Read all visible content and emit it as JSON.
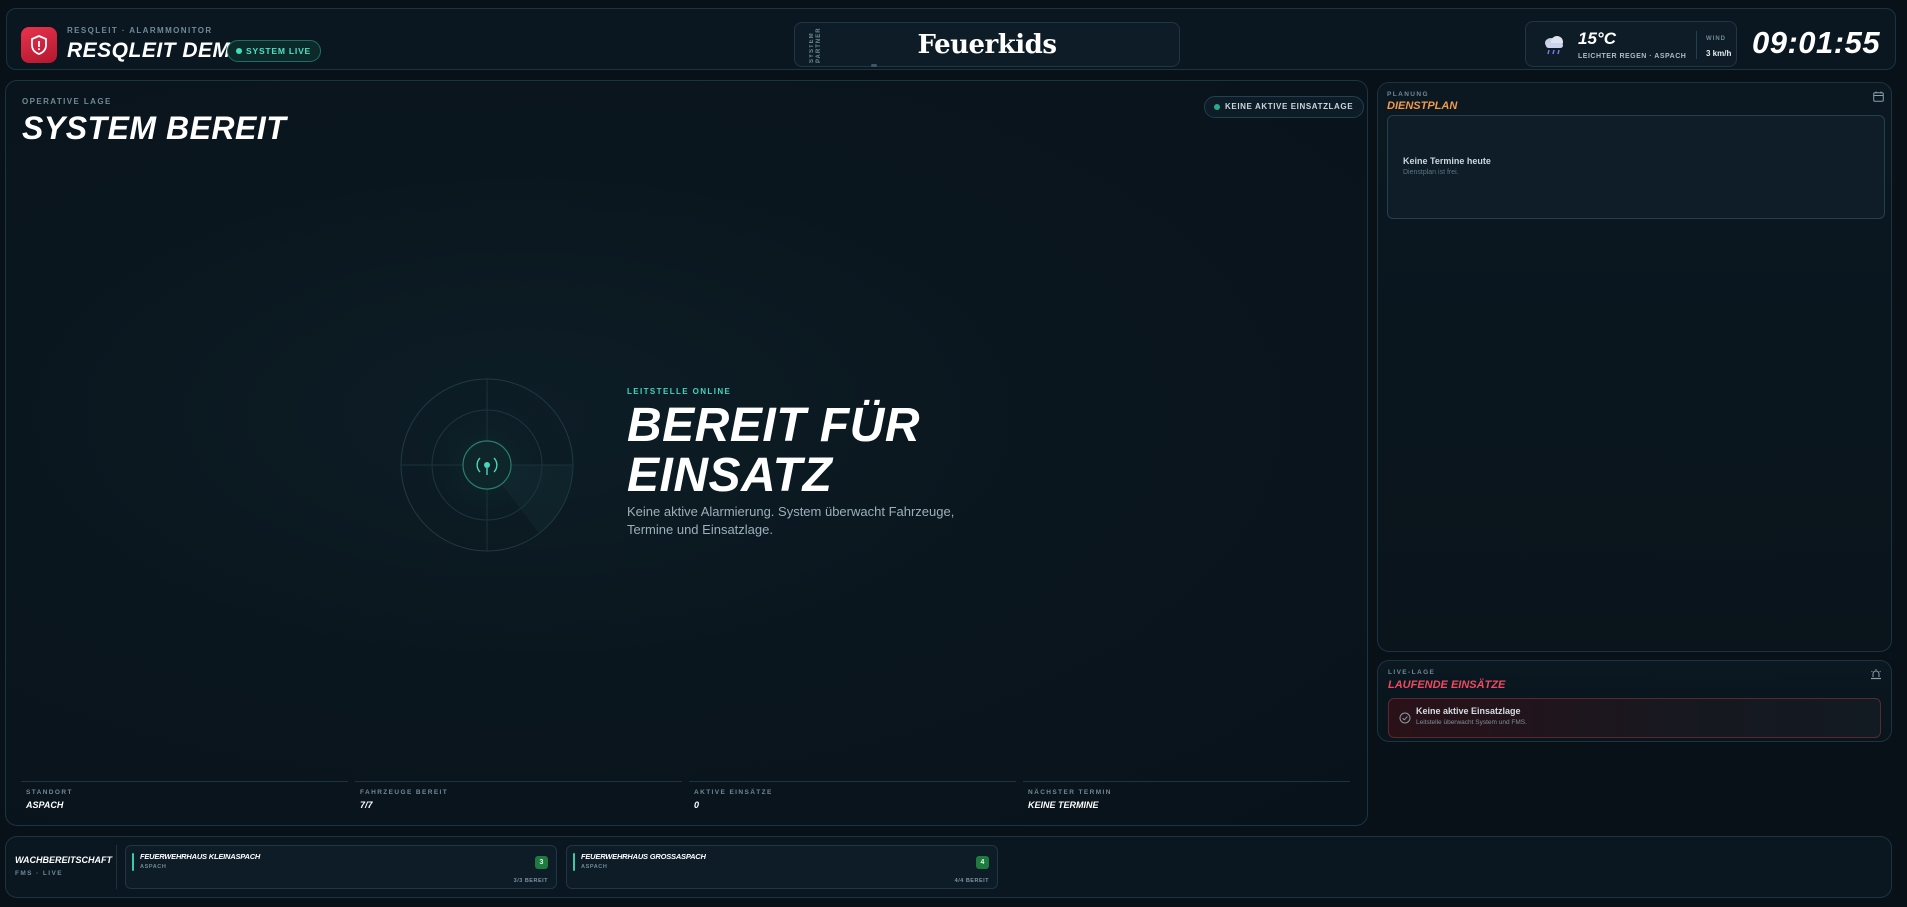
{
  "header": {
    "brand_subtitle": "RESQLEIT · ALARMMONITOR",
    "brand_title": "RESQLEIT DEMO",
    "live_badge": "SYSTEM LIVE",
    "partner_label": "SYSTEM PARTNER",
    "partner_name": "Feuerkids",
    "weather": {
      "icon": "rain-cloud-icon",
      "temperature": "15°C",
      "description": "LEICHTER REGEN · ASPACH",
      "wind_label": "WIND",
      "wind_value": "3 km/h"
    },
    "clock": "09:01:55"
  },
  "main": {
    "label": "OPERATIVE LAGE",
    "title": "SYSTEM BEREIT",
    "status_badge": "KEINE AKTIVE EINSATZLAGE",
    "ready_subtitle": "LEITSTELLE ONLINE",
    "ready_title_line1": "BEREIT FÜR",
    "ready_title_line2": "EINSATZ",
    "ready_text": "Keine aktive Alarmierung. System überwacht Fahrzeuge, Termine und Einsatzlage.",
    "stats": [
      {
        "label": "STANDORT",
        "value": "ASPACH"
      },
      {
        "label": "FAHRZEUGE BEREIT",
        "value": "7/7"
      },
      {
        "label": "AKTIVE EINSÄTZE",
        "value": "0"
      },
      {
        "label": "NÄCHSTER TERMIN",
        "value": "KEINE TERMINE"
      }
    ]
  },
  "dienstplan": {
    "label": "PLANUNG",
    "title": "DIENSTPLAN",
    "card_title": "Keine Termine heute",
    "card_text": "Dienstplan ist frei."
  },
  "laufende": {
    "label": "LIVE-LAGE",
    "title": "LAUFENDE EINSÄTZE",
    "card_title": "Keine aktive Einsatzlage",
    "card_text": "Leitstelle überwacht System und FMS."
  },
  "bottom": {
    "title": "WACHBEREITSCHAFT",
    "subtitle": "FMS · LIVE",
    "stations": [
      {
        "name": "FEUERWEHRHAUS KLEINASPACH",
        "location": "ASPACH",
        "count": "3",
        "ready": "3/3 BEREIT"
      },
      {
        "name": "FEUERWEHRHAUS GROSSASPACH",
        "location": "ASPACH",
        "count": "4",
        "ready": "4/4 BEREIT"
      }
    ]
  },
  "colors": {
    "background": "#081118",
    "accent_teal": "#44d4bb",
    "dienstplan_orange": "#f19a4a",
    "alert_red": "#f0495e",
    "brand_red": "#d8263e"
  }
}
